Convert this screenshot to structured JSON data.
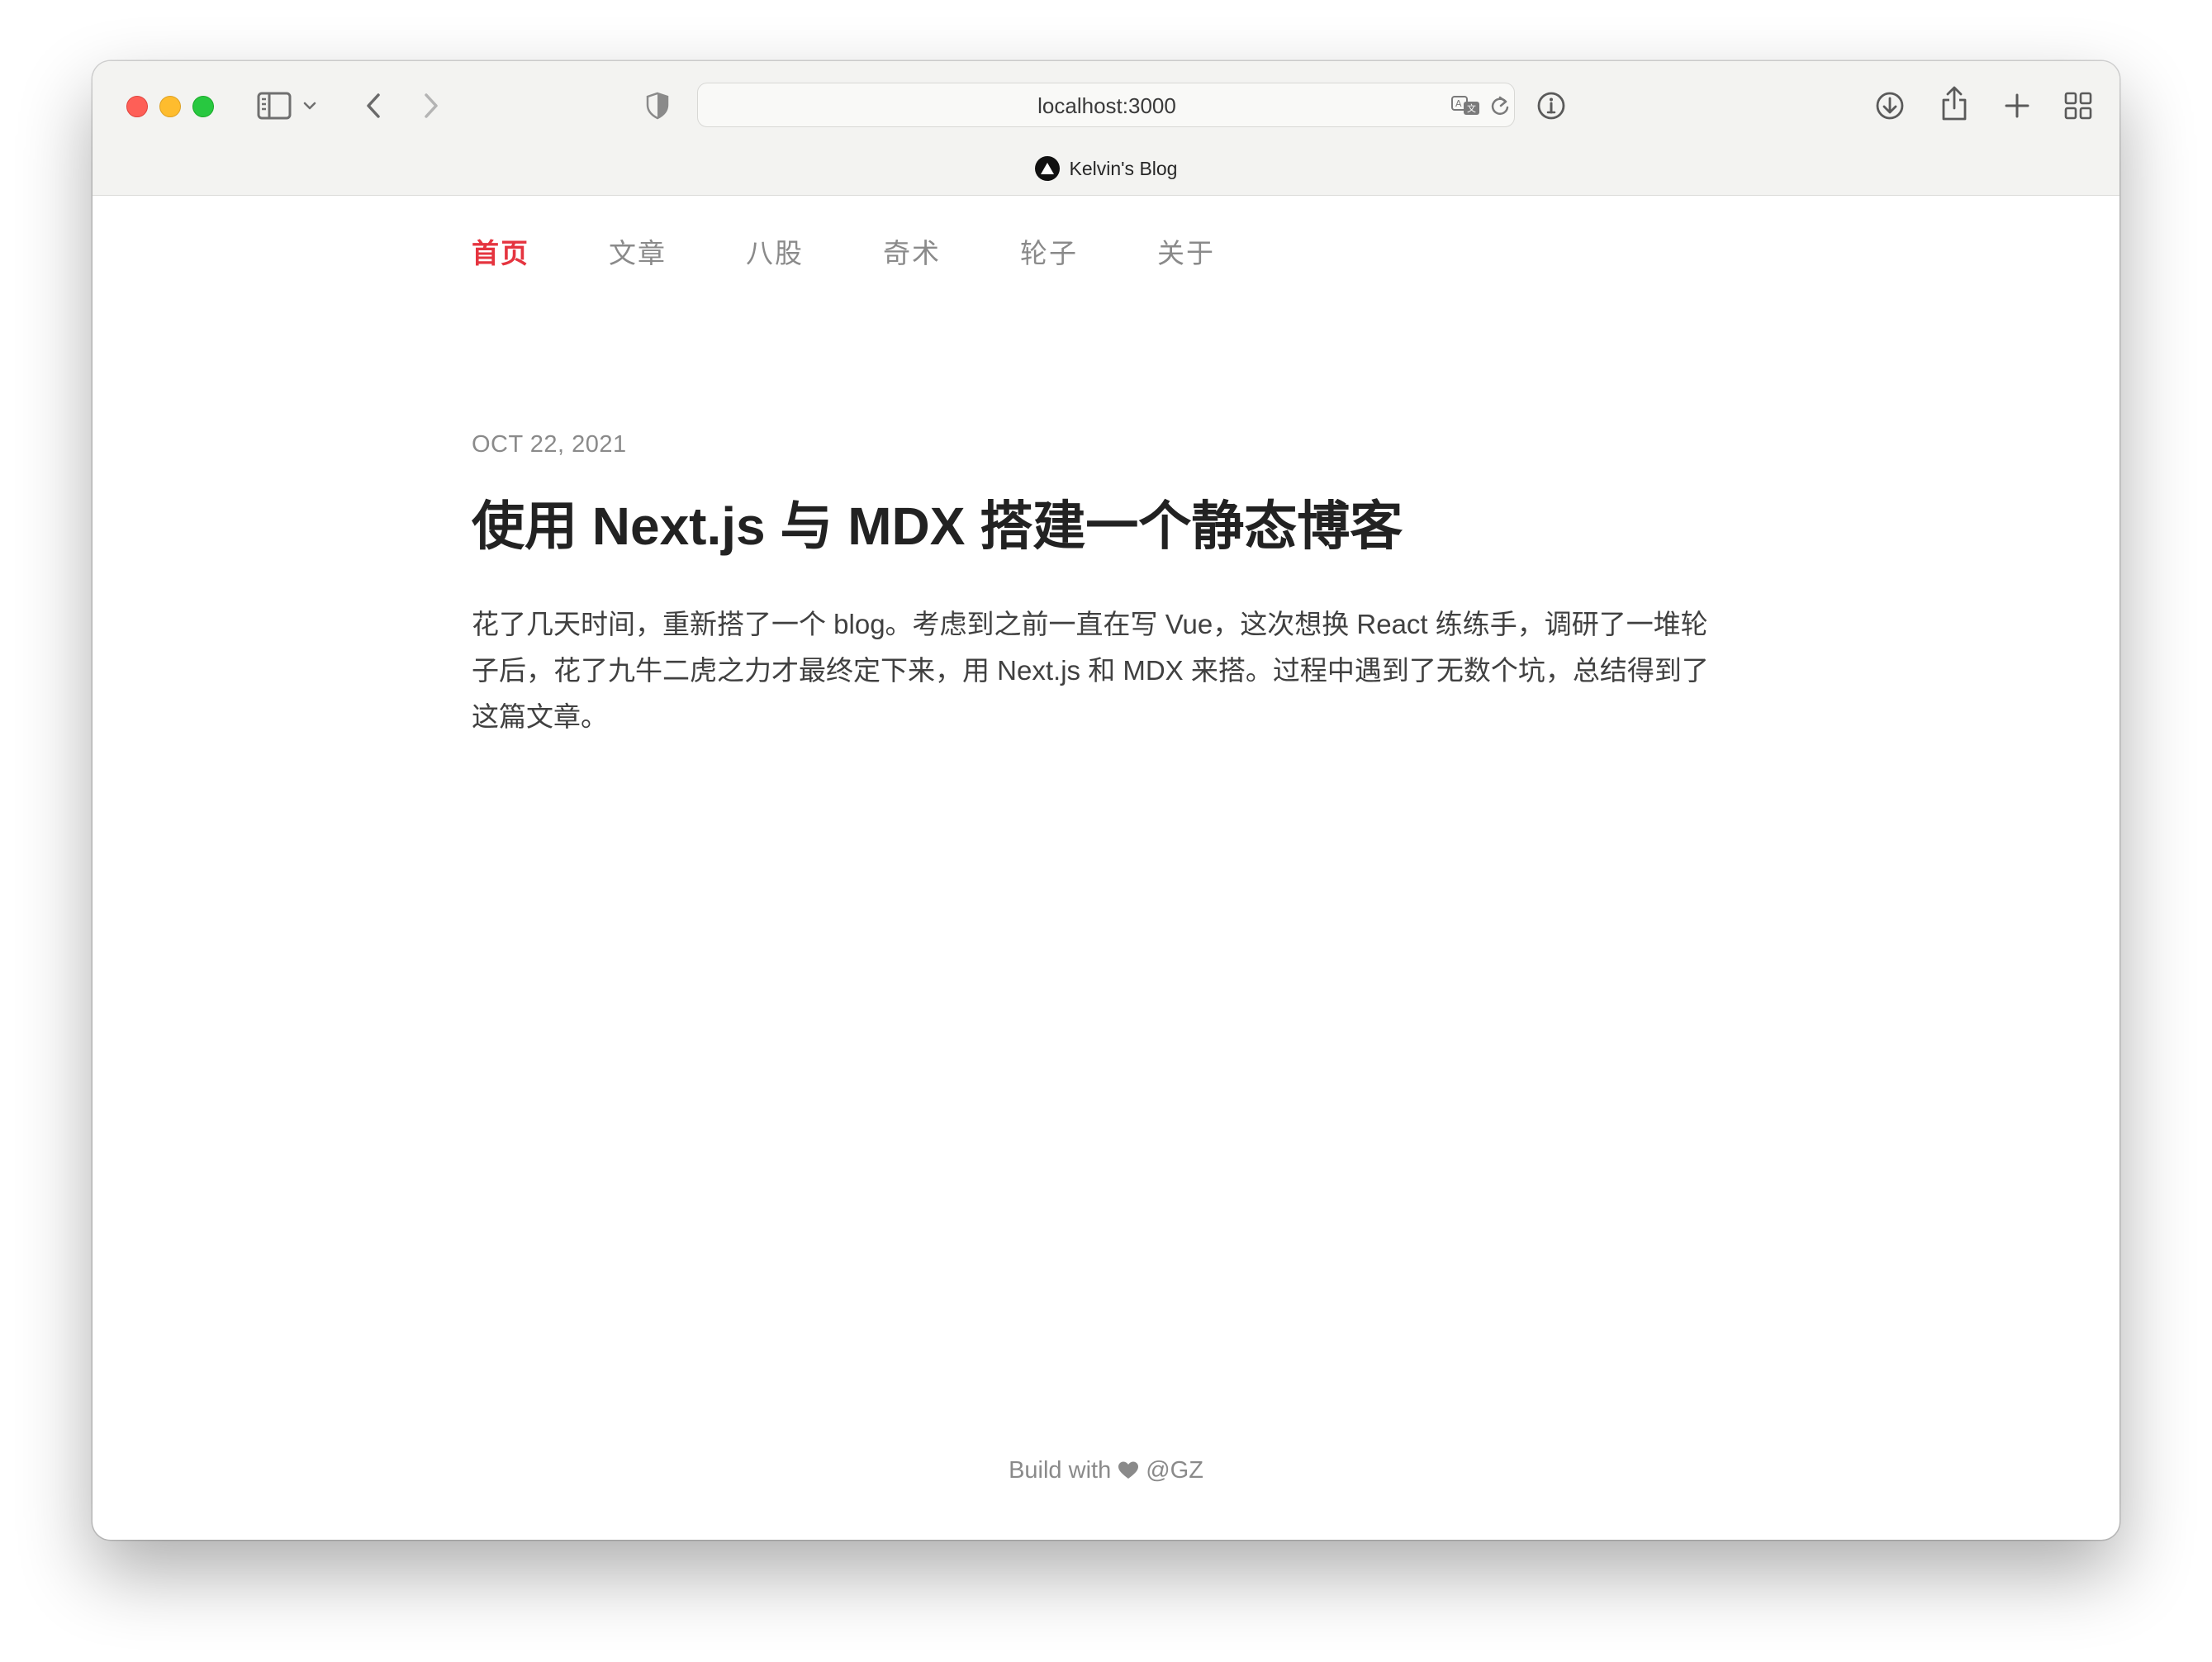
{
  "browser": {
    "url": "localhost:3000",
    "tab_title": "Kelvin's Blog",
    "icons": {
      "sidebar": "sidebar-icon",
      "sidebar_menu": "chevron-down-icon",
      "back": "chevron-left-icon",
      "forward": "chevron-right-icon",
      "privacy": "shield-icon",
      "translate": "translate-icon",
      "reload": "reload-icon",
      "info": "info-icon",
      "downloads": "download-icon",
      "share": "share-icon",
      "new_tab": "plus-icon",
      "tab_overview": "grid-icon"
    }
  },
  "nav": {
    "items": [
      {
        "label": "首页",
        "active": true
      },
      {
        "label": "文章",
        "active": false
      },
      {
        "label": "八股",
        "active": false
      },
      {
        "label": "奇术",
        "active": false
      },
      {
        "label": "轮子",
        "active": false
      },
      {
        "label": "关于",
        "active": false
      }
    ],
    "active_color": "#e5343f"
  },
  "post": {
    "date": "OCT 22, 2021",
    "title": "使用 Next.js 与 MDX 搭建一个静态博客",
    "summary": "花了几天时间，重新搭了一个 blog。考虑到之前一直在写 Vue，这次想换 React 练练手，调研了一堆轮子后，花了九牛二虎之力才最终定下来，用 Next.js 和 MDX 来搭。过程中遇到了无数个坑，总结得到了这篇文章。"
  },
  "footer": {
    "prefix": "Build with",
    "icon": "heart-icon",
    "suffix": "@GZ"
  }
}
